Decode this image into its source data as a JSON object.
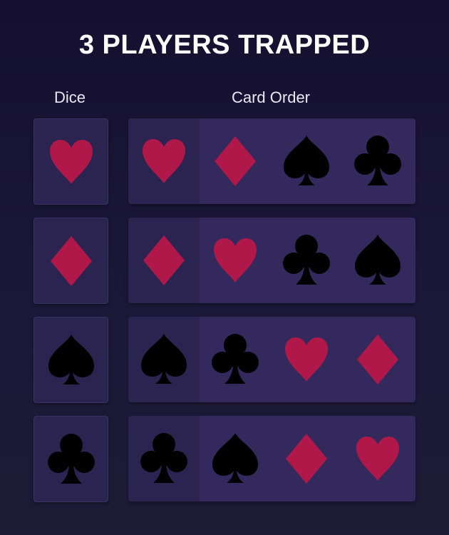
{
  "title": "3 PLAYERS TRAPPED",
  "headers": {
    "dice": "Dice",
    "card_order": "Card Order"
  },
  "colors": {
    "red": "#b0184a",
    "black": "#000000",
    "background": "#1c1838",
    "panel": "#33295c",
    "panel_dark": "#2c2450"
  },
  "rows": [
    {
      "dice": "heart-icon",
      "cards": [
        "heart-icon",
        "diamond-icon",
        "spade-icon",
        "club-icon"
      ]
    },
    {
      "dice": "diamond-icon",
      "cards": [
        "diamond-icon",
        "heart-icon",
        "club-icon",
        "spade-icon"
      ]
    },
    {
      "dice": "spade-icon",
      "cards": [
        "spade-icon",
        "club-icon",
        "heart-icon",
        "diamond-icon"
      ]
    },
    {
      "dice": "club-icon",
      "cards": [
        "club-icon",
        "spade-icon",
        "diamond-icon",
        "heart-icon"
      ]
    }
  ]
}
